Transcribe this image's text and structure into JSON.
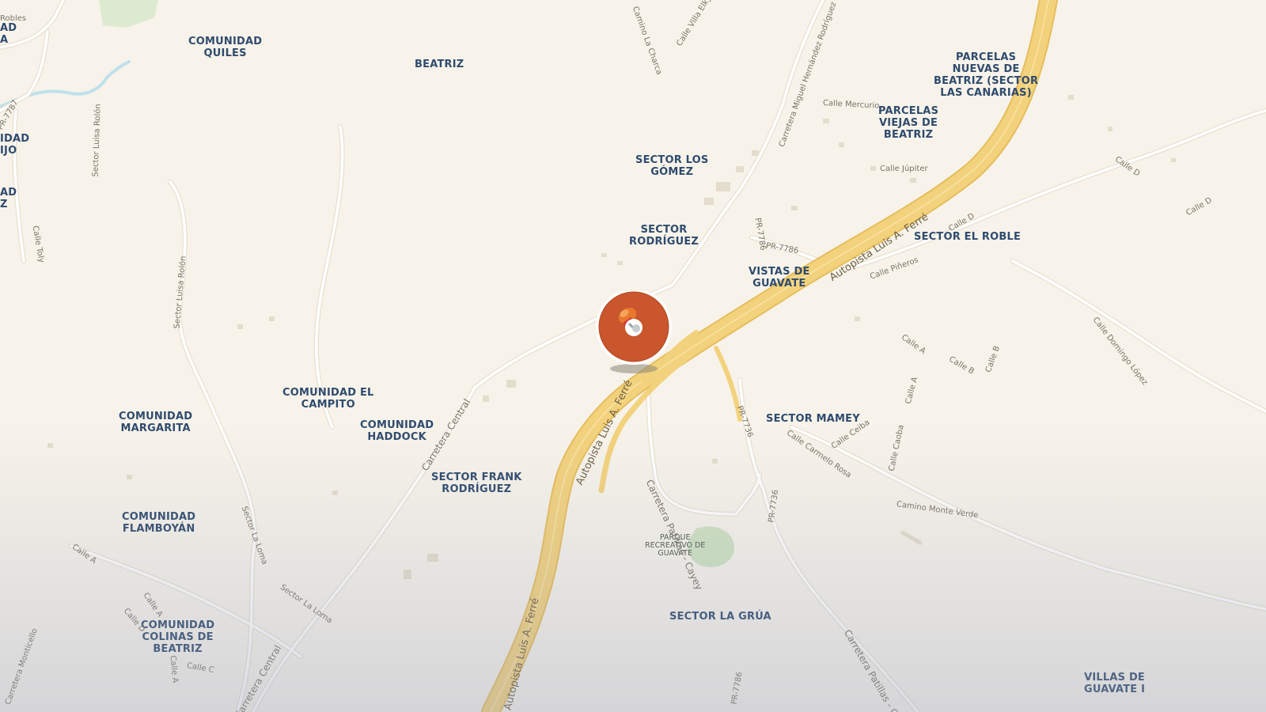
{
  "map": {
    "colors": {
      "land": "#f7f3ea",
      "highway": "#f3d27d",
      "highway_edge": "#e6bd5c",
      "road": "#ffffff",
      "road_edge": "#e8e1cf",
      "park": "#cfe2c2",
      "water": "#bfe0ec",
      "label": "#2f4b6e",
      "marker": "#c9562c"
    },
    "places": [
      "COMUNIDAD\nQUILES",
      "BEATRIZ",
      "PARCELAS\nNUEVAS DE\nBEATRIZ (SECTOR\nLAS CANARIAS)",
      "PARCELAS\nVIEJAS DE\nBEATRIZ",
      "SECTOR LOS\nGÓMEZ",
      "SECTOR\nRODRÍGUEZ",
      "VISTAS DE\nGUAVATE",
      "SECTOR EL ROBLE",
      "COMUNIDAD EL\nCAMPITO",
      "COMUNIDAD\nMARGARITA",
      "COMUNIDAD\nHADDOCK",
      "SECTOR FRANK\nRODRÍGUEZ",
      "SECTOR MAMEY",
      "COMUNIDAD\nFLAMBOYÁN",
      "SECTOR LA GRÚA",
      "COMUNIDAD\nCOLINAS DE\nBEATRIZ",
      "VILLAS DE\nGUAVATE I",
      "AD\nA",
      "IDAD\nIJO",
      "AD\nZ"
    ],
    "park_label": "PARQUE\nRECREATIVO DE\nGUAVATE",
    "highways": [
      "Autopista Luis A. Ferré",
      "Autopista Luis A. Ferré",
      "Autopista Luis A. Ferré"
    ],
    "streets": [
      "Carretera Miguel Hernández Rodríguez",
      "Calle Mercurio",
      "Calle Júpiter",
      "PR-7786",
      "PR-7786",
      "Calle Piñeros",
      "Calle D",
      "Calle D",
      "Calle D",
      "Calle Domingo López",
      "Calle A",
      "Calle B",
      "Calle B",
      "Calle A",
      "PR-7736",
      "PR-7736",
      "Calle Carmelo Rosa",
      "Calle Ceiba",
      "Calle Caoba",
      "Camino Monte Verde",
      "Carretera Patillas - Cayey",
      "Carretera Patillas - Cayey",
      "Carretera Central",
      "Carretera Central",
      "Sector Luisa Rolón",
      "Sector Luisa Rolón",
      "Sector La Loma",
      "Sector La Loma",
      "Calle A",
      "Calle A",
      "Calle D",
      "Calle C",
      "Calle A",
      "Calle Villa Elky",
      "Camino La Charca",
      "PR-7787",
      "Calle Toly",
      "Robles",
      "Carretera Monticello",
      "PR-7786"
    ],
    "marker": {
      "name": "location-pin"
    }
  }
}
